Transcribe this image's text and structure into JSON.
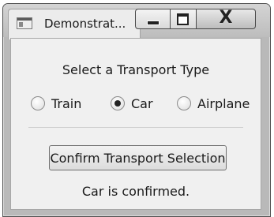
{
  "window": {
    "title": "Demonstrat...",
    "caption_buttons": {
      "minimize": "–",
      "maximize": "□",
      "close": "X"
    }
  },
  "content": {
    "heading": "Select a Transport Type",
    "options": [
      {
        "label": "Train",
        "checked": false
      },
      {
        "label": "Car",
        "checked": true
      },
      {
        "label": "Airplane",
        "checked": false
      }
    ],
    "confirm_button_label": "Confirm Transport Selection",
    "status_message": "Car is confirmed."
  }
}
